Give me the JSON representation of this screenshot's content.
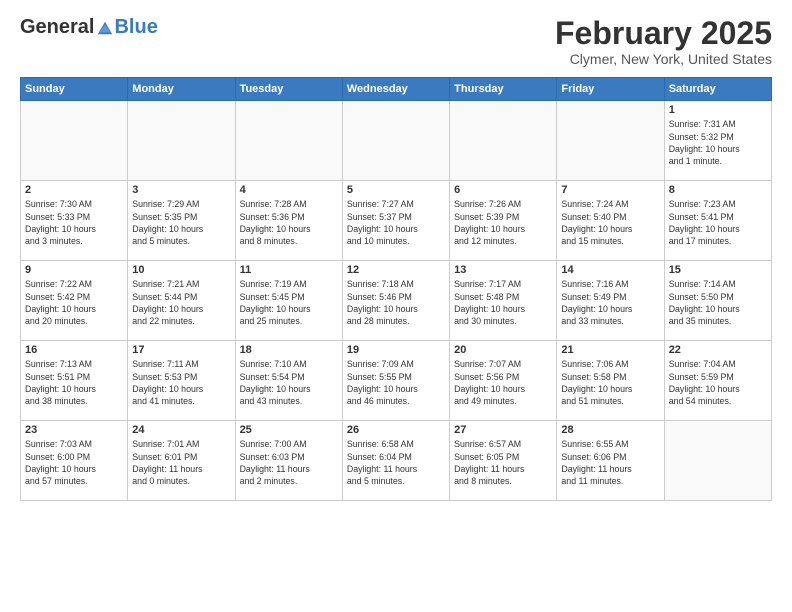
{
  "header": {
    "logo_general": "General",
    "logo_blue": "Blue",
    "title": "February 2025",
    "subtitle": "Clymer, New York, United States"
  },
  "weekdays": [
    "Sunday",
    "Monday",
    "Tuesday",
    "Wednesday",
    "Thursday",
    "Friday",
    "Saturday"
  ],
  "weeks": [
    [
      {
        "day": "",
        "info": ""
      },
      {
        "day": "",
        "info": ""
      },
      {
        "day": "",
        "info": ""
      },
      {
        "day": "",
        "info": ""
      },
      {
        "day": "",
        "info": ""
      },
      {
        "day": "",
        "info": ""
      },
      {
        "day": "1",
        "info": "Sunrise: 7:31 AM\nSunset: 5:32 PM\nDaylight: 10 hours\nand 1 minute."
      }
    ],
    [
      {
        "day": "2",
        "info": "Sunrise: 7:30 AM\nSunset: 5:33 PM\nDaylight: 10 hours\nand 3 minutes."
      },
      {
        "day": "3",
        "info": "Sunrise: 7:29 AM\nSunset: 5:35 PM\nDaylight: 10 hours\nand 5 minutes."
      },
      {
        "day": "4",
        "info": "Sunrise: 7:28 AM\nSunset: 5:36 PM\nDaylight: 10 hours\nand 8 minutes."
      },
      {
        "day": "5",
        "info": "Sunrise: 7:27 AM\nSunset: 5:37 PM\nDaylight: 10 hours\nand 10 minutes."
      },
      {
        "day": "6",
        "info": "Sunrise: 7:26 AM\nSunset: 5:39 PM\nDaylight: 10 hours\nand 12 minutes."
      },
      {
        "day": "7",
        "info": "Sunrise: 7:24 AM\nSunset: 5:40 PM\nDaylight: 10 hours\nand 15 minutes."
      },
      {
        "day": "8",
        "info": "Sunrise: 7:23 AM\nSunset: 5:41 PM\nDaylight: 10 hours\nand 17 minutes."
      }
    ],
    [
      {
        "day": "9",
        "info": "Sunrise: 7:22 AM\nSunset: 5:42 PM\nDaylight: 10 hours\nand 20 minutes."
      },
      {
        "day": "10",
        "info": "Sunrise: 7:21 AM\nSunset: 5:44 PM\nDaylight: 10 hours\nand 22 minutes."
      },
      {
        "day": "11",
        "info": "Sunrise: 7:19 AM\nSunset: 5:45 PM\nDaylight: 10 hours\nand 25 minutes."
      },
      {
        "day": "12",
        "info": "Sunrise: 7:18 AM\nSunset: 5:46 PM\nDaylight: 10 hours\nand 28 minutes."
      },
      {
        "day": "13",
        "info": "Sunrise: 7:17 AM\nSunset: 5:48 PM\nDaylight: 10 hours\nand 30 minutes."
      },
      {
        "day": "14",
        "info": "Sunrise: 7:16 AM\nSunset: 5:49 PM\nDaylight: 10 hours\nand 33 minutes."
      },
      {
        "day": "15",
        "info": "Sunrise: 7:14 AM\nSunset: 5:50 PM\nDaylight: 10 hours\nand 35 minutes."
      }
    ],
    [
      {
        "day": "16",
        "info": "Sunrise: 7:13 AM\nSunset: 5:51 PM\nDaylight: 10 hours\nand 38 minutes."
      },
      {
        "day": "17",
        "info": "Sunrise: 7:11 AM\nSunset: 5:53 PM\nDaylight: 10 hours\nand 41 minutes."
      },
      {
        "day": "18",
        "info": "Sunrise: 7:10 AM\nSunset: 5:54 PM\nDaylight: 10 hours\nand 43 minutes."
      },
      {
        "day": "19",
        "info": "Sunrise: 7:09 AM\nSunset: 5:55 PM\nDaylight: 10 hours\nand 46 minutes."
      },
      {
        "day": "20",
        "info": "Sunrise: 7:07 AM\nSunset: 5:56 PM\nDaylight: 10 hours\nand 49 minutes."
      },
      {
        "day": "21",
        "info": "Sunrise: 7:06 AM\nSunset: 5:58 PM\nDaylight: 10 hours\nand 51 minutes."
      },
      {
        "day": "22",
        "info": "Sunrise: 7:04 AM\nSunset: 5:59 PM\nDaylight: 10 hours\nand 54 minutes."
      }
    ],
    [
      {
        "day": "23",
        "info": "Sunrise: 7:03 AM\nSunset: 6:00 PM\nDaylight: 10 hours\nand 57 minutes."
      },
      {
        "day": "24",
        "info": "Sunrise: 7:01 AM\nSunset: 6:01 PM\nDaylight: 11 hours\nand 0 minutes."
      },
      {
        "day": "25",
        "info": "Sunrise: 7:00 AM\nSunset: 6:03 PM\nDaylight: 11 hours\nand 2 minutes."
      },
      {
        "day": "26",
        "info": "Sunrise: 6:58 AM\nSunset: 6:04 PM\nDaylight: 11 hours\nand 5 minutes."
      },
      {
        "day": "27",
        "info": "Sunrise: 6:57 AM\nSunset: 6:05 PM\nDaylight: 11 hours\nand 8 minutes."
      },
      {
        "day": "28",
        "info": "Sunrise: 6:55 AM\nSunset: 6:06 PM\nDaylight: 11 hours\nand 11 minutes."
      },
      {
        "day": "",
        "info": ""
      }
    ]
  ]
}
